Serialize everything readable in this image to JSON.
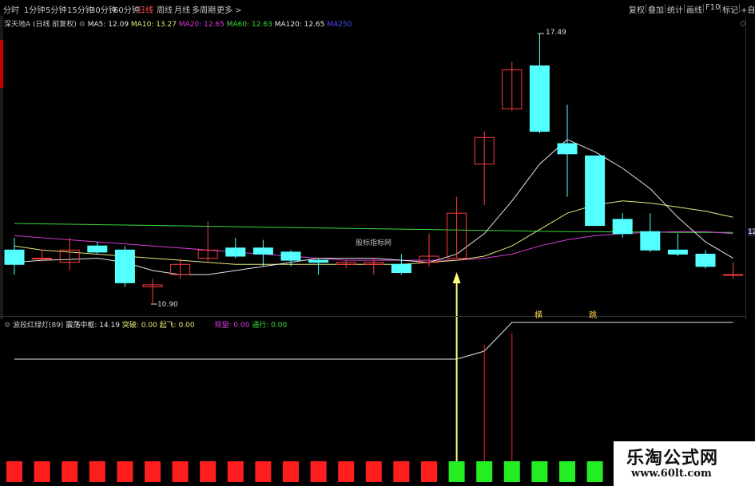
{
  "topbar": {
    "timeframes": [
      "分时",
      "1分钟",
      "5分钟",
      "15分钟",
      "30分钟",
      "60分钟",
      "日线",
      "周线",
      "月线",
      "多周期",
      "更多 >"
    ],
    "active": "日线",
    "title_partial": "深天地A · 日线",
    "right_buttons": [
      "复权",
      "叠加",
      "统计",
      "画线",
      "F10",
      "标记",
      "+自选"
    ]
  },
  "main_legend": {
    "stock": "深天地A (日线 前复权)",
    "ma5": "MA5: 12.09",
    "ma10": "MA10: 13.27",
    "ma20": "MA20: 12.65",
    "ma60": "MA60: 12.63",
    "ma120": "MA120: 12.65",
    "ma250": "MA250"
  },
  "annotations": {
    "high": "17.49",
    "low": "10.90",
    "watermark": "股标指标网",
    "right_price": "12"
  },
  "sub_legend": {
    "name": "波段红绿灯(89)",
    "a": "震荡中枢: 14.19",
    "b": "突破: 0.00",
    "c": "起飞: 0.00",
    "d": "观望: 0.00",
    "e": "通行: 0.00"
  },
  "sub_marks": {
    "m1": "横",
    "m2": "跳"
  },
  "colors": {
    "up": "#ff3c3c",
    "down": "#54ffff",
    "ma5": "#e6e6e6",
    "ma10": "#e6e67a",
    "ma20": "#d83cd8",
    "ma60": "#3cdc3c",
    "ma120": "#e6e6e6",
    "ma250": "#3c3cff",
    "signal_red": "#ff1e1e",
    "signal_green": "#22ee22",
    "arrow": "#ffff80"
  },
  "chart_data": {
    "type": "candlestick",
    "candles": [
      {
        "o": 12.2,
        "c": 11.85,
        "h": 12.5,
        "l": 11.6
      },
      {
        "o": 12.0,
        "c": 12.0,
        "h": 12.2,
        "l": 11.9
      },
      {
        "o": 11.9,
        "c": 12.2,
        "h": 12.5,
        "l": 11.7
      },
      {
        "o": 12.3,
        "c": 12.15,
        "h": 12.4,
        "l": 12.1
      },
      {
        "o": 12.2,
        "c": 11.4,
        "h": 12.3,
        "l": 11.3
      },
      {
        "o": 11.3,
        "c": 11.35,
        "h": 11.5,
        "l": 10.9
      },
      {
        "o": 11.6,
        "c": 11.85,
        "h": 12.0,
        "l": 11.5
      },
      {
        "o": 12.0,
        "c": 12.2,
        "h": 12.9,
        "l": 11.9
      },
      {
        "o": 12.25,
        "c": 12.05,
        "h": 12.5,
        "l": 12.0
      },
      {
        "o": 12.25,
        "c": 12.1,
        "h": 12.45,
        "l": 11.8
      },
      {
        "o": 12.15,
        "c": 11.95,
        "h": 12.2,
        "l": 11.8
      },
      {
        "o": 11.95,
        "c": 11.9,
        "h": 12.0,
        "l": 11.6
      },
      {
        "o": 11.85,
        "c": 11.9,
        "h": 11.95,
        "l": 11.75
      },
      {
        "o": 11.85,
        "c": 11.9,
        "h": 12.0,
        "l": 11.6
      },
      {
        "o": 11.85,
        "c": 11.65,
        "h": 12.1,
        "l": 11.6
      },
      {
        "o": 11.9,
        "c": 12.05,
        "h": 12.6,
        "l": 11.8
      },
      {
        "o": 12.0,
        "c": 13.1,
        "h": 13.5,
        "l": 12.0
      },
      {
        "o": 14.3,
        "c": 14.95,
        "h": 15.1,
        "l": 13.3
      },
      {
        "o": 15.65,
        "c": 16.6,
        "h": 16.8,
        "l": 15.6
      },
      {
        "o": 16.7,
        "c": 15.1,
        "h": 17.49,
        "l": 15.05
      },
      {
        "o": 14.8,
        "c": 14.55,
        "h": 15.75,
        "l": 13.5
      },
      {
        "o": 14.5,
        "c": 12.8,
        "h": 14.5,
        "l": 12.8
      },
      {
        "o": 12.95,
        "c": 12.6,
        "h": 13.1,
        "l": 12.5
      },
      {
        "o": 12.65,
        "c": 12.2,
        "h": 13.1,
        "l": 12.15
      },
      {
        "o": 12.2,
        "c": 12.1,
        "h": 12.6,
        "l": 12.05
      },
      {
        "o": 12.1,
        "c": 11.8,
        "h": 12.2,
        "l": 11.75
      },
      {
        "o": 11.6,
        "c": 11.6,
        "h": 11.9,
        "l": 11.5
      }
    ],
    "ma5": [
      11.9,
      11.95,
      11.97,
      12.0,
      11.9,
      11.7,
      11.6,
      11.6,
      11.7,
      11.8,
      11.9,
      12.0,
      12.0,
      12.0,
      11.95,
      11.9,
      12.1,
      12.6,
      13.4,
      14.3,
      14.9,
      14.6,
      14.2,
      13.7,
      13.0,
      12.4,
      12.0
    ],
    "ma10": [
      12.3,
      12.2,
      12.15,
      12.1,
      12.05,
      12.0,
      11.95,
      11.9,
      11.85,
      11.85,
      11.85,
      11.85,
      11.85,
      11.85,
      11.85,
      11.9,
      11.95,
      12.05,
      12.3,
      12.7,
      13.1,
      13.3,
      13.4,
      13.35,
      13.25,
      13.15,
      13.0
    ],
    "ma20": [
      12.55,
      12.5,
      12.45,
      12.4,
      12.35,
      12.3,
      12.25,
      12.2,
      12.15,
      12.1,
      12.05,
      12.0,
      11.95,
      11.95,
      11.95,
      11.95,
      11.95,
      12.0,
      12.1,
      12.3,
      12.45,
      12.55,
      12.6,
      12.63,
      12.65,
      12.65,
      12.6
    ],
    "ma60": [
      12.85,
      12.84,
      12.83,
      12.82,
      12.81,
      12.8,
      12.79,
      12.78,
      12.77,
      12.76,
      12.75,
      12.74,
      12.73,
      12.72,
      12.71,
      12.7,
      12.69,
      12.68,
      12.67,
      12.66,
      12.65,
      12.65,
      12.64,
      12.64,
      12.63,
      12.63,
      12.63
    ],
    "line_sub": [
      0.55,
      0.55,
      0.55,
      0.55,
      0.55,
      0.55,
      0.55,
      0.55,
      0.55,
      0.55,
      0.55,
      0.55,
      0.55,
      0.55,
      0.55,
      0.55,
      0.55,
      0.6,
      0.78,
      0.78,
      0.78,
      0.78,
      0.78,
      0.78,
      0.78,
      0.78,
      0.78
    ],
    "signals": [
      "red",
      "red",
      "red",
      "red",
      "red",
      "red",
      "red",
      "red",
      "red",
      "red",
      "red",
      "red",
      "red",
      "red",
      "red",
      "red",
      "green",
      "green",
      "green",
      "green",
      "green",
      "green",
      "red",
      "red",
      "red",
      "red",
      "red"
    ],
    "spikes": [
      17,
      18
    ]
  }
}
